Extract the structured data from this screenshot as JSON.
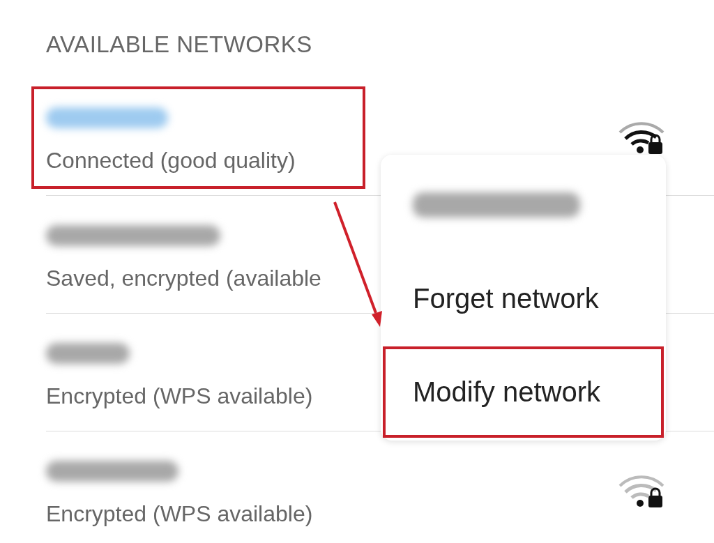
{
  "section_header": "AVAILABLE NETWORKS",
  "networks": [
    {
      "status": "Connected (good quality)",
      "connected": true,
      "signal_icon": {
        "strong": true
      }
    },
    {
      "status": "Saved, encrypted (available",
      "connected": false
    },
    {
      "status": "Encrypted (WPS available)",
      "connected": false
    },
    {
      "status": "Encrypted (WPS available)",
      "connected": false,
      "signal_icon": {
        "strong": false
      }
    }
  ],
  "context_menu": {
    "items": [
      "Forget network",
      "Modify network"
    ]
  }
}
